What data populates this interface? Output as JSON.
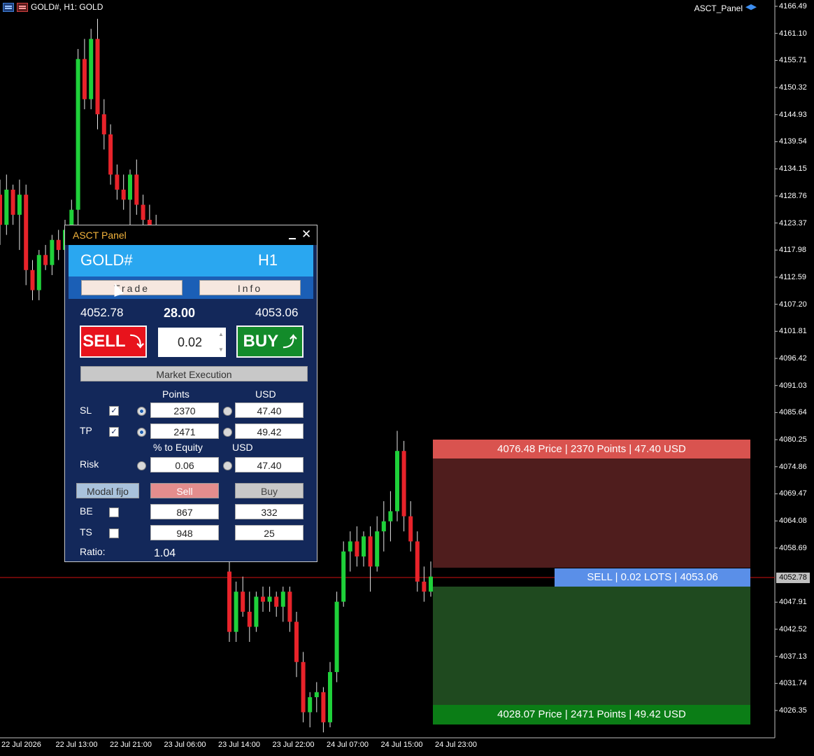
{
  "chart": {
    "title": "GOLD#, H1: GOLD",
    "ea_name": "ASCT_Panel",
    "current_price": "4052.78",
    "price_axis": [
      "4166.49",
      "4161.10",
      "4155.71",
      "4150.32",
      "4144.93",
      "4139.54",
      "4134.15",
      "4128.76",
      "4123.37",
      "4117.98",
      "4112.59",
      "4107.20",
      "4101.81",
      "4096.42",
      "4091.03",
      "4085.64",
      "4080.25",
      "4074.86",
      "4069.47",
      "4064.08",
      "4058.69",
      "4047.91",
      "4042.52",
      "4037.13",
      "4031.74",
      "4026.35"
    ],
    "time_axis": [
      "22 Jul 2026",
      "22 Jul 13:00",
      "22 Jul 21:00",
      "23 Jul 06:00",
      "23 Jul 14:00",
      "23 Jul 22:00",
      "24 Jul 07:00",
      "24 Jul 15:00",
      "24 Jul 23:00"
    ],
    "colors": {
      "bull": "#1fd13a",
      "bear": "#e8232a",
      "price_line": "#d01010"
    },
    "candles": [
      [
        4129,
        4132,
        4119,
        4123
      ],
      [
        4123,
        4133,
        4121,
        4130
      ],
      [
        4130,
        4131,
        4123,
        4125
      ],
      [
        4125,
        4132,
        4118,
        4129
      ],
      [
        4129,
        4131,
        4111,
        4114
      ],
      [
        4114,
        4116,
        4108,
        4110
      ],
      [
        4110,
        4118,
        4108,
        4117
      ],
      [
        4117,
        4119,
        4114,
        4115
      ],
      [
        4115,
        4121,
        4113,
        4120
      ],
      [
        4120,
        4122,
        4116,
        4118
      ],
      [
        4118,
        4124,
        4117,
        4122
      ],
      [
        4122,
        4128,
        4118,
        4126
      ],
      [
        4126,
        4158,
        4120,
        4156
      ],
      [
        4156,
        4160,
        4146,
        4148
      ],
      [
        4148,
        4162,
        4146,
        4160
      ],
      [
        4160,
        4164,
        4142,
        4145
      ],
      [
        4145,
        4148,
        4138,
        4141
      ],
      [
        4141,
        4143,
        4131,
        4133
      ],
      [
        4133,
        4135,
        4128,
        4130
      ],
      [
        4130,
        4133,
        4126,
        4128
      ],
      [
        4128,
        4134,
        4123,
        4133
      ],
      [
        4133,
        4136,
        4125,
        4127
      ],
      [
        4127,
        4129,
        4120,
        4124
      ],
      [
        4124,
        4127,
        4119,
        4121
      ],
      [
        4121,
        4125,
        4118,
        4123
      ]
    ],
    "candles_right": [
      [
        4054,
        4056,
        4040,
        4042
      ],
      [
        4042,
        4052,
        4040,
        4050
      ],
      [
        4050,
        4053,
        4045,
        4046
      ],
      [
        4046,
        4050,
        4040,
        4043
      ],
      [
        4043,
        4050,
        4042,
        4049
      ],
      [
        4049,
        4051,
        4046,
        4048
      ],
      [
        4048,
        4051,
        4046,
        4049
      ],
      [
        4049,
        4050,
        4045,
        4047
      ],
      [
        4047,
        4051,
        4044,
        4050
      ],
      [
        4050,
        4051,
        4042,
        4044
      ],
      [
        4044,
        4046,
        4033,
        4036
      ],
      [
        4036,
        4038,
        4024,
        4026
      ],
      [
        4026,
        4030,
        4023,
        4029
      ],
      [
        4029,
        4032,
        4026,
        4030
      ],
      [
        4030,
        4031,
        4022,
        4024
      ],
      [
        4024,
        4036,
        4023,
        4034
      ],
      [
        4034,
        4050,
        4032,
        4048
      ],
      [
        4048,
        4060,
        4047,
        4058
      ],
      [
        4058,
        4062,
        4054,
        4060
      ],
      [
        4060,
        4063,
        4055,
        4057
      ],
      [
        4057,
        4062,
        4055,
        4061
      ],
      [
        4061,
        4063,
        4050,
        4055
      ],
      [
        4055,
        4065,
        4054,
        4062
      ],
      [
        4062,
        4068,
        4058,
        4064
      ],
      [
        4064,
        4070,
        4060,
        4066
      ],
      [
        4066,
        4082,
        4064,
        4078
      ],
      [
        4078,
        4080,
        4062,
        4065
      ],
      [
        4065,
        4068,
        4058,
        4060
      ],
      [
        4060,
        4062,
        4050,
        4052
      ],
      [
        4052,
        4055,
        4048,
        4050
      ],
      [
        4050,
        4056,
        4049,
        4053
      ]
    ],
    "sl_label": "4076.48 Price | 2370 Points | 47.40 USD",
    "tp_label": "4028.07 Price | 2471 Points | 49.42 USD",
    "entry_label": "SELL | 0.02 LOTS | 4053.06"
  },
  "panel": {
    "title": "ASCT Panel",
    "symbol": "GOLD#",
    "timeframe": "H1",
    "tabs": {
      "trade": "Trade",
      "info": "Info"
    },
    "bid": "4052.78",
    "spread": "28.00",
    "ask": "4053.06",
    "sell_label": "SELL",
    "buy_label": "BUY",
    "lot": "0.02",
    "execution": "Market Execution",
    "headers": {
      "points": "Points",
      "usd": "USD",
      "equity": "% to Equity",
      "usd2": "USD"
    },
    "sl": {
      "label": "SL",
      "points": "2370",
      "usd": "47.40"
    },
    "tp": {
      "label": "TP",
      "points": "2471",
      "usd": "49.42"
    },
    "risk": {
      "label": "Risk",
      "equity": "0.06",
      "usd": "47.40"
    },
    "buttons": {
      "modal": "Modal fijo",
      "sell": "Sell",
      "buy": "Buy"
    },
    "be": {
      "label": "BE",
      "sell": "867",
      "buy": "332"
    },
    "ts": {
      "label": "TS",
      "sell": "948",
      "buy": "25"
    },
    "ratio": {
      "label": "Ratio:",
      "value": "1.04"
    }
  }
}
